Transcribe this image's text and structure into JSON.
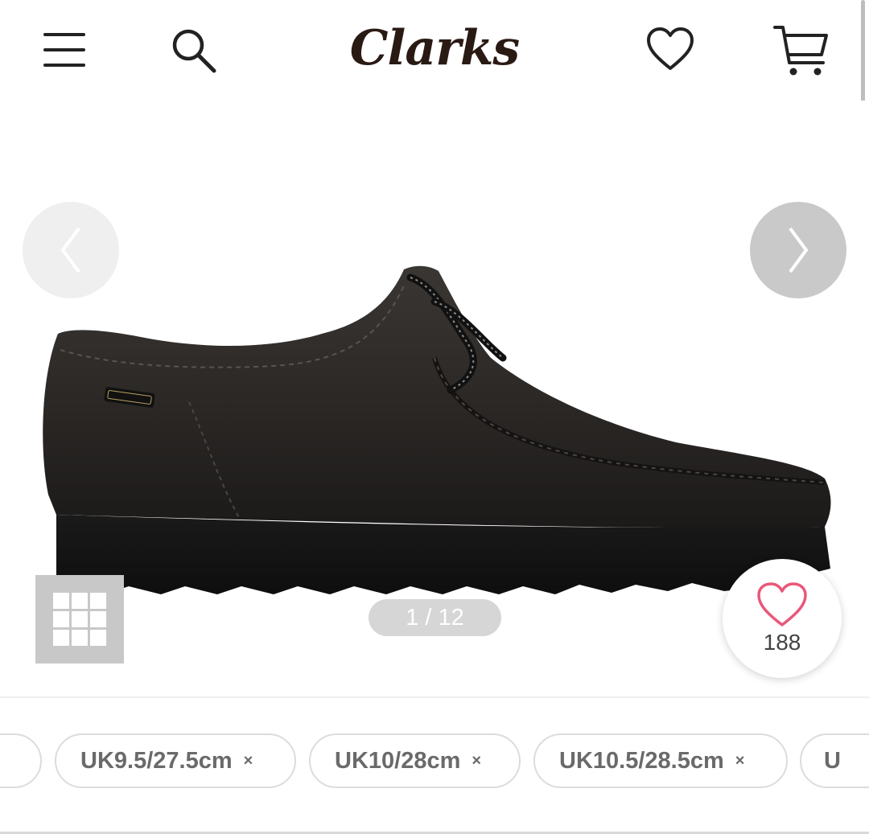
{
  "header": {
    "brand": "Clarks",
    "menu_icon": "hamburger-menu-icon",
    "search_icon": "search-icon",
    "wishlist_icon": "heart-outline-icon",
    "cart_icon": "shopping-cart-icon"
  },
  "gallery": {
    "counter": "1 / 12",
    "prev_icon": "chevron-left-icon",
    "next_icon": "chevron-right-icon",
    "grid_icon": "grid-view-icon",
    "product_image": "black-leather-wallabee-shoe",
    "like_icon": "heart-outline-icon",
    "like_count": "188",
    "like_color": "#e8587a"
  },
  "sizes": {
    "chips": [
      {
        "label": "UK9.5/27.5cm",
        "remove": "×"
      },
      {
        "label": "UK10/28cm",
        "remove": "×"
      },
      {
        "label": "UK10.5/28.5cm",
        "remove": "×"
      },
      {
        "label": "U",
        "remove": ""
      }
    ]
  }
}
